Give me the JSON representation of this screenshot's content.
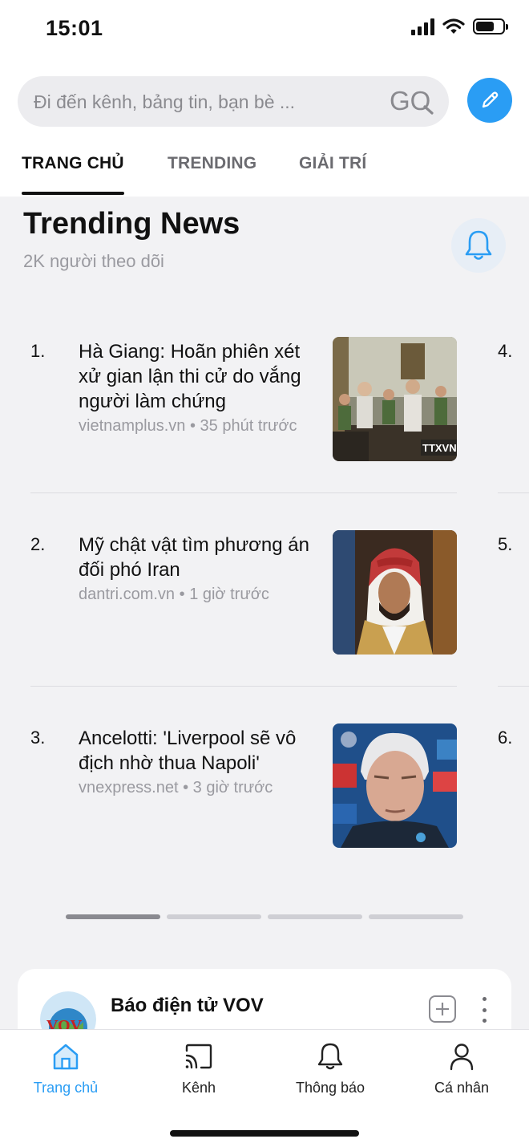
{
  "status_bar": {
    "time": "15:01"
  },
  "search": {
    "placeholder": "Đi đến kênh, bảng tin, bạn bè ...",
    "go_label": "GO"
  },
  "tabs": [
    {
      "label": "TRANG CHỦ",
      "active": true
    },
    {
      "label": "TRENDING",
      "active": false
    },
    {
      "label": "GIẢI TRÍ",
      "active": false
    }
  ],
  "trending": {
    "title": "Trending News",
    "followers": "2K người theo dõi",
    "items": [
      {
        "num": "1.",
        "title": "Hà Giang: Hoãn phiên xét xử gian lận thi cử do vắng người làm chứng",
        "source": "vietnamplus.vn",
        "time": "35 phút trước",
        "thumb_watermark": "TTXVN"
      },
      {
        "num": "2.",
        "title": "Mỹ chật vật tìm phương án đối phó Iran",
        "source": "dantri.com.vn",
        "time": "1 giờ trước"
      },
      {
        "num": "3.",
        "title": "Ancelotti: 'Liverpool sẽ vô địch nhờ thua Napoli'",
        "source": "vnexpress.net",
        "time": "3 giờ trước"
      }
    ],
    "next_column_nums": [
      "4.",
      "5.",
      "6."
    ],
    "pager": {
      "pages": 4,
      "active": 1
    }
  },
  "channel": {
    "name": "Báo điện tử VOV",
    "logo_text": "VOV"
  },
  "bottom_nav": [
    {
      "label": "Trang chủ",
      "icon": "home-icon",
      "active": true
    },
    {
      "label": "Kênh",
      "icon": "cast-icon",
      "active": false
    },
    {
      "label": "Thông báo",
      "icon": "bell-icon",
      "active": false
    },
    {
      "label": "Cá nhân",
      "icon": "person-icon",
      "active": false
    }
  ],
  "colors": {
    "accent": "#2a9df4",
    "background": "#f2f2f4",
    "text": "#111111",
    "muted": "#9a9aa0"
  },
  "battery_level": 0.7
}
